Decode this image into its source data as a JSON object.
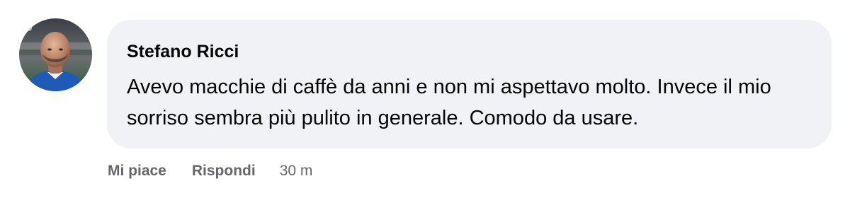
{
  "comment": {
    "author": "Stefano Ricci",
    "text": "Avevo macchie di caffè da anni e non mi aspettavo molto. Invece il mio sorriso sembra più pulito in generale. Comodo da usare.",
    "avatar_icon": "profile-photo",
    "actions": {
      "like_label": "Mi piace",
      "reply_label": "Rispondi",
      "timestamp": "30 m"
    }
  },
  "colors": {
    "bubble_background": "#f0f2f5",
    "text": "#050505",
    "secondary_text": "#65676b",
    "jersey_blue": "#1e5bb8"
  }
}
